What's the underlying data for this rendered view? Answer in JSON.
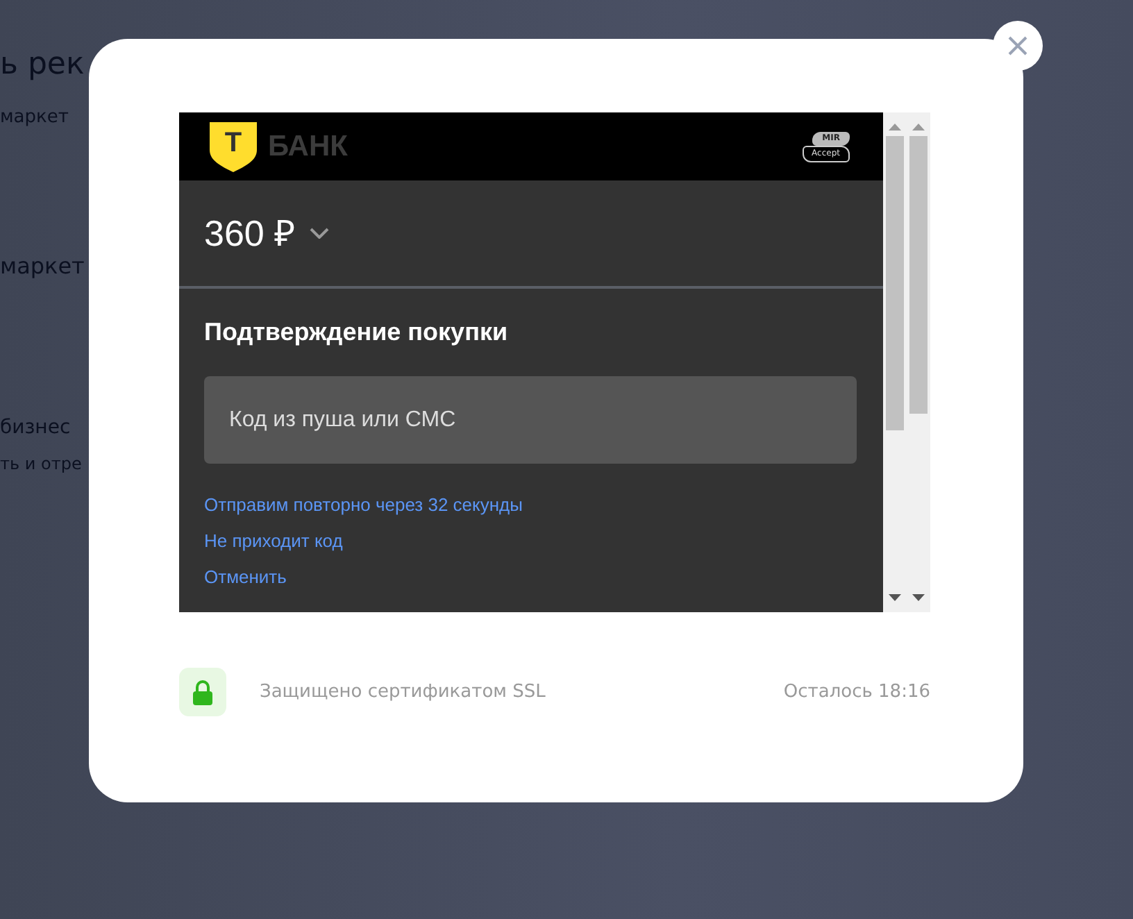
{
  "background_page": {
    "texts": [
      "ь рек",
      "маркет",
      "маркет",
      "бизнес",
      "ть и отре"
    ]
  },
  "payment_frame": {
    "bank_name": "БАНК",
    "logo_letter": "Т",
    "badge_top": "MIR",
    "badge_bottom": "Accept",
    "amount": "360 ₽",
    "heading": "Подтверждение покупки",
    "code_field": {
      "placeholder": "Код из пуша или СМС"
    },
    "links": [
      "Отправим повторно через 32 секунды",
      "Не приходит код",
      "Отменить"
    ]
  },
  "footer": {
    "security_text": "Защищено сертификатом SSL",
    "time_left": "Осталось 18:16"
  }
}
